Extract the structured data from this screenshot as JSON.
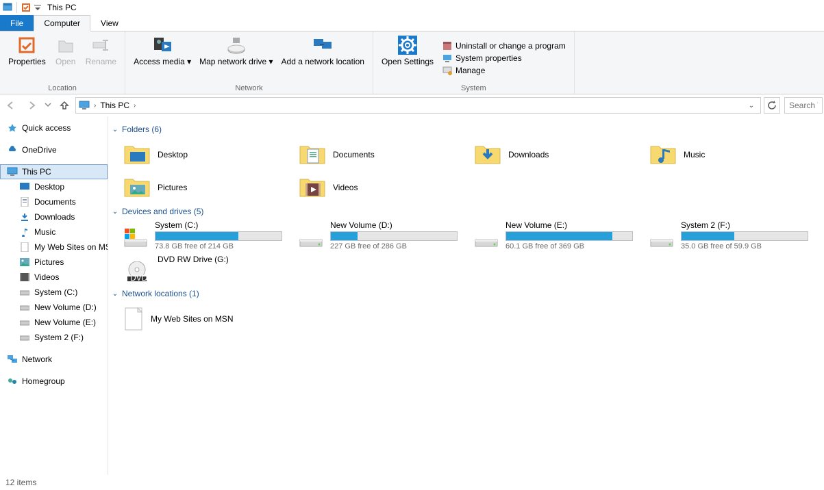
{
  "window": {
    "title": "This PC"
  },
  "ribbon_tabs": {
    "file": "File",
    "computer": "Computer",
    "view": "View"
  },
  "ribbon": {
    "location": {
      "properties": "Properties",
      "open": "Open",
      "rename": "Rename",
      "group_label": "Location"
    },
    "network": {
      "access_media": "Access media",
      "map_drive": "Map network drive",
      "add_location": "Add a network location",
      "group_label": "Network"
    },
    "system": {
      "open_settings": "Open Settings",
      "uninstall": "Uninstall or change a program",
      "sysprops": "System properties",
      "manage": "Manage",
      "group_label": "System"
    }
  },
  "address": {
    "this_pc": "This PC",
    "search_placeholder": "Search This PC"
  },
  "sidebar": {
    "quick_access": "Quick access",
    "onedrive": "OneDrive",
    "this_pc": "This PC",
    "desktop": "Desktop",
    "documents": "Documents",
    "downloads": "Downloads",
    "music": "Music",
    "my_web_sites": "My Web Sites on MSN",
    "pictures": "Pictures",
    "videos": "Videos",
    "system_c": "System (C:)",
    "new_vol_d": "New Volume (D:)",
    "new_vol_e": "New Volume (E:)",
    "system2_f": "System 2 (F:)",
    "network": "Network",
    "homegroup": "Homegroup"
  },
  "sections": {
    "folders": "Folders (6)",
    "devices": "Devices and drives (5)",
    "netloc": "Network locations (1)"
  },
  "folders": {
    "desktop": "Desktop",
    "documents": "Documents",
    "downloads": "Downloads",
    "music": "Music",
    "pictures": "Pictures",
    "videos": "Videos"
  },
  "drives": [
    {
      "name": "System (C:)",
      "free": "73.8 GB free of 214 GB",
      "fill_pct": 66
    },
    {
      "name": "New Volume (D:)",
      "free": "227 GB free of 286 GB",
      "fill_pct": 21
    },
    {
      "name": "New Volume (E:)",
      "free": "60.1 GB free of 369 GB",
      "fill_pct": 84
    },
    {
      "name": "System 2 (F:)",
      "free": "35.0 GB free of 59.9 GB",
      "fill_pct": 42
    },
    {
      "name": "DVD RW Drive (G:)",
      "free": "",
      "fill_pct": -1
    }
  ],
  "netloc": {
    "item0": "My Web Sites on MSN"
  },
  "status": {
    "items": "12 items"
  }
}
